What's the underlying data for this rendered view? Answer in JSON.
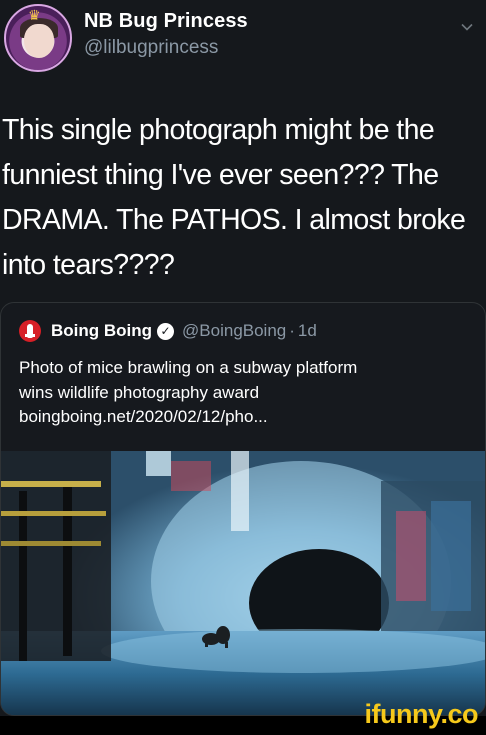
{
  "author": {
    "display_name": "NB Bug Princess",
    "handle": "@lilbugprincess"
  },
  "tweet": {
    "lines": [
      "This single photograph might be the",
      "funniest thing I've ever seen??? The",
      "DRAMA. The PATHOS. I almost broke",
      "into tears????"
    ]
  },
  "quoted_tweet": {
    "display_name": "Boing Boing",
    "handle": "@BoingBoing",
    "separator": "·",
    "time": "1d",
    "lines": [
      "Photo of mice brawling on a subway platform",
      "wins wildlife photography award",
      "boingboing.net/2020/02/12/pho..."
    ]
  },
  "watermark": "ifunny.co",
  "icons": {
    "menu": "chevron-down-icon",
    "verified": "verified-badge-icon",
    "brand": "boingboing-logo-icon"
  },
  "colors": {
    "background": "#15181c",
    "secondary_text": "#8b98a5",
    "watermark": "#f6c91b"
  }
}
